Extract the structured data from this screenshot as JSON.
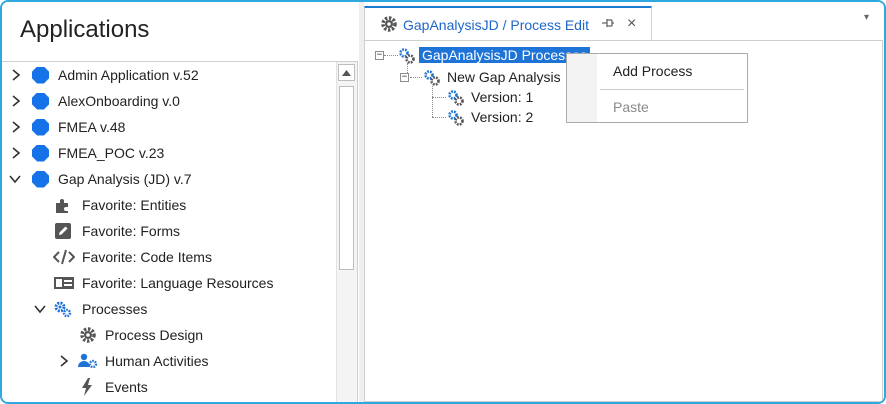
{
  "left_panel": {
    "title": "Applications",
    "tree": [
      {
        "label": "Admin Application v.52",
        "icon": "application-icon",
        "expanded": false
      },
      {
        "label": "AlexOnboarding v.0",
        "icon": "application-icon",
        "expanded": false
      },
      {
        "label": "FMEA v.48",
        "icon": "application-icon",
        "expanded": false
      },
      {
        "label": "FMEA_POC v.23",
        "icon": "application-icon",
        "expanded": false
      },
      {
        "label": "Gap Analysis (JD) v.7",
        "icon": "application-icon",
        "expanded": true
      },
      {
        "label": "Favorite: Entities",
        "icon": "puzzle-icon"
      },
      {
        "label": "Favorite: Forms",
        "icon": "pencil-icon"
      },
      {
        "label": "Favorite: Code Items",
        "icon": "code-icon"
      },
      {
        "label": "Favorite: Language Resources",
        "icon": "language-icon"
      },
      {
        "label": "Processes",
        "icon": "gears-icon",
        "expanded": true
      },
      {
        "label": "Process Design",
        "icon": "gear-icon"
      },
      {
        "label": "Human Activities",
        "icon": "users-gear-icon",
        "expanded": false
      },
      {
        "label": "Events",
        "icon": "lightning-icon"
      }
    ]
  },
  "right_panel": {
    "tab": {
      "title": "GapAnalysisJD / Process Edit",
      "pin_icon": "pin-icon",
      "close_label": "×",
      "menu_label": "▾"
    },
    "process_tree": {
      "root": "GapAnalysisJD Processes",
      "child": "New Gap Analysis",
      "versions": [
        "Version: 1",
        "Version: 2"
      ],
      "expander_collapse": "−"
    }
  },
  "context_menu": {
    "items": [
      {
        "label": "Add Process",
        "enabled": true
      },
      {
        "label": "Paste",
        "enabled": false
      }
    ]
  },
  "colors": {
    "frame_border": "#2fa8e0",
    "app_dot": "#1572e8",
    "selection": "#1e73d6",
    "tab_accent": "#1e7bd3",
    "icon_gray": "#555555",
    "icon_blue": "#1e73d6"
  }
}
